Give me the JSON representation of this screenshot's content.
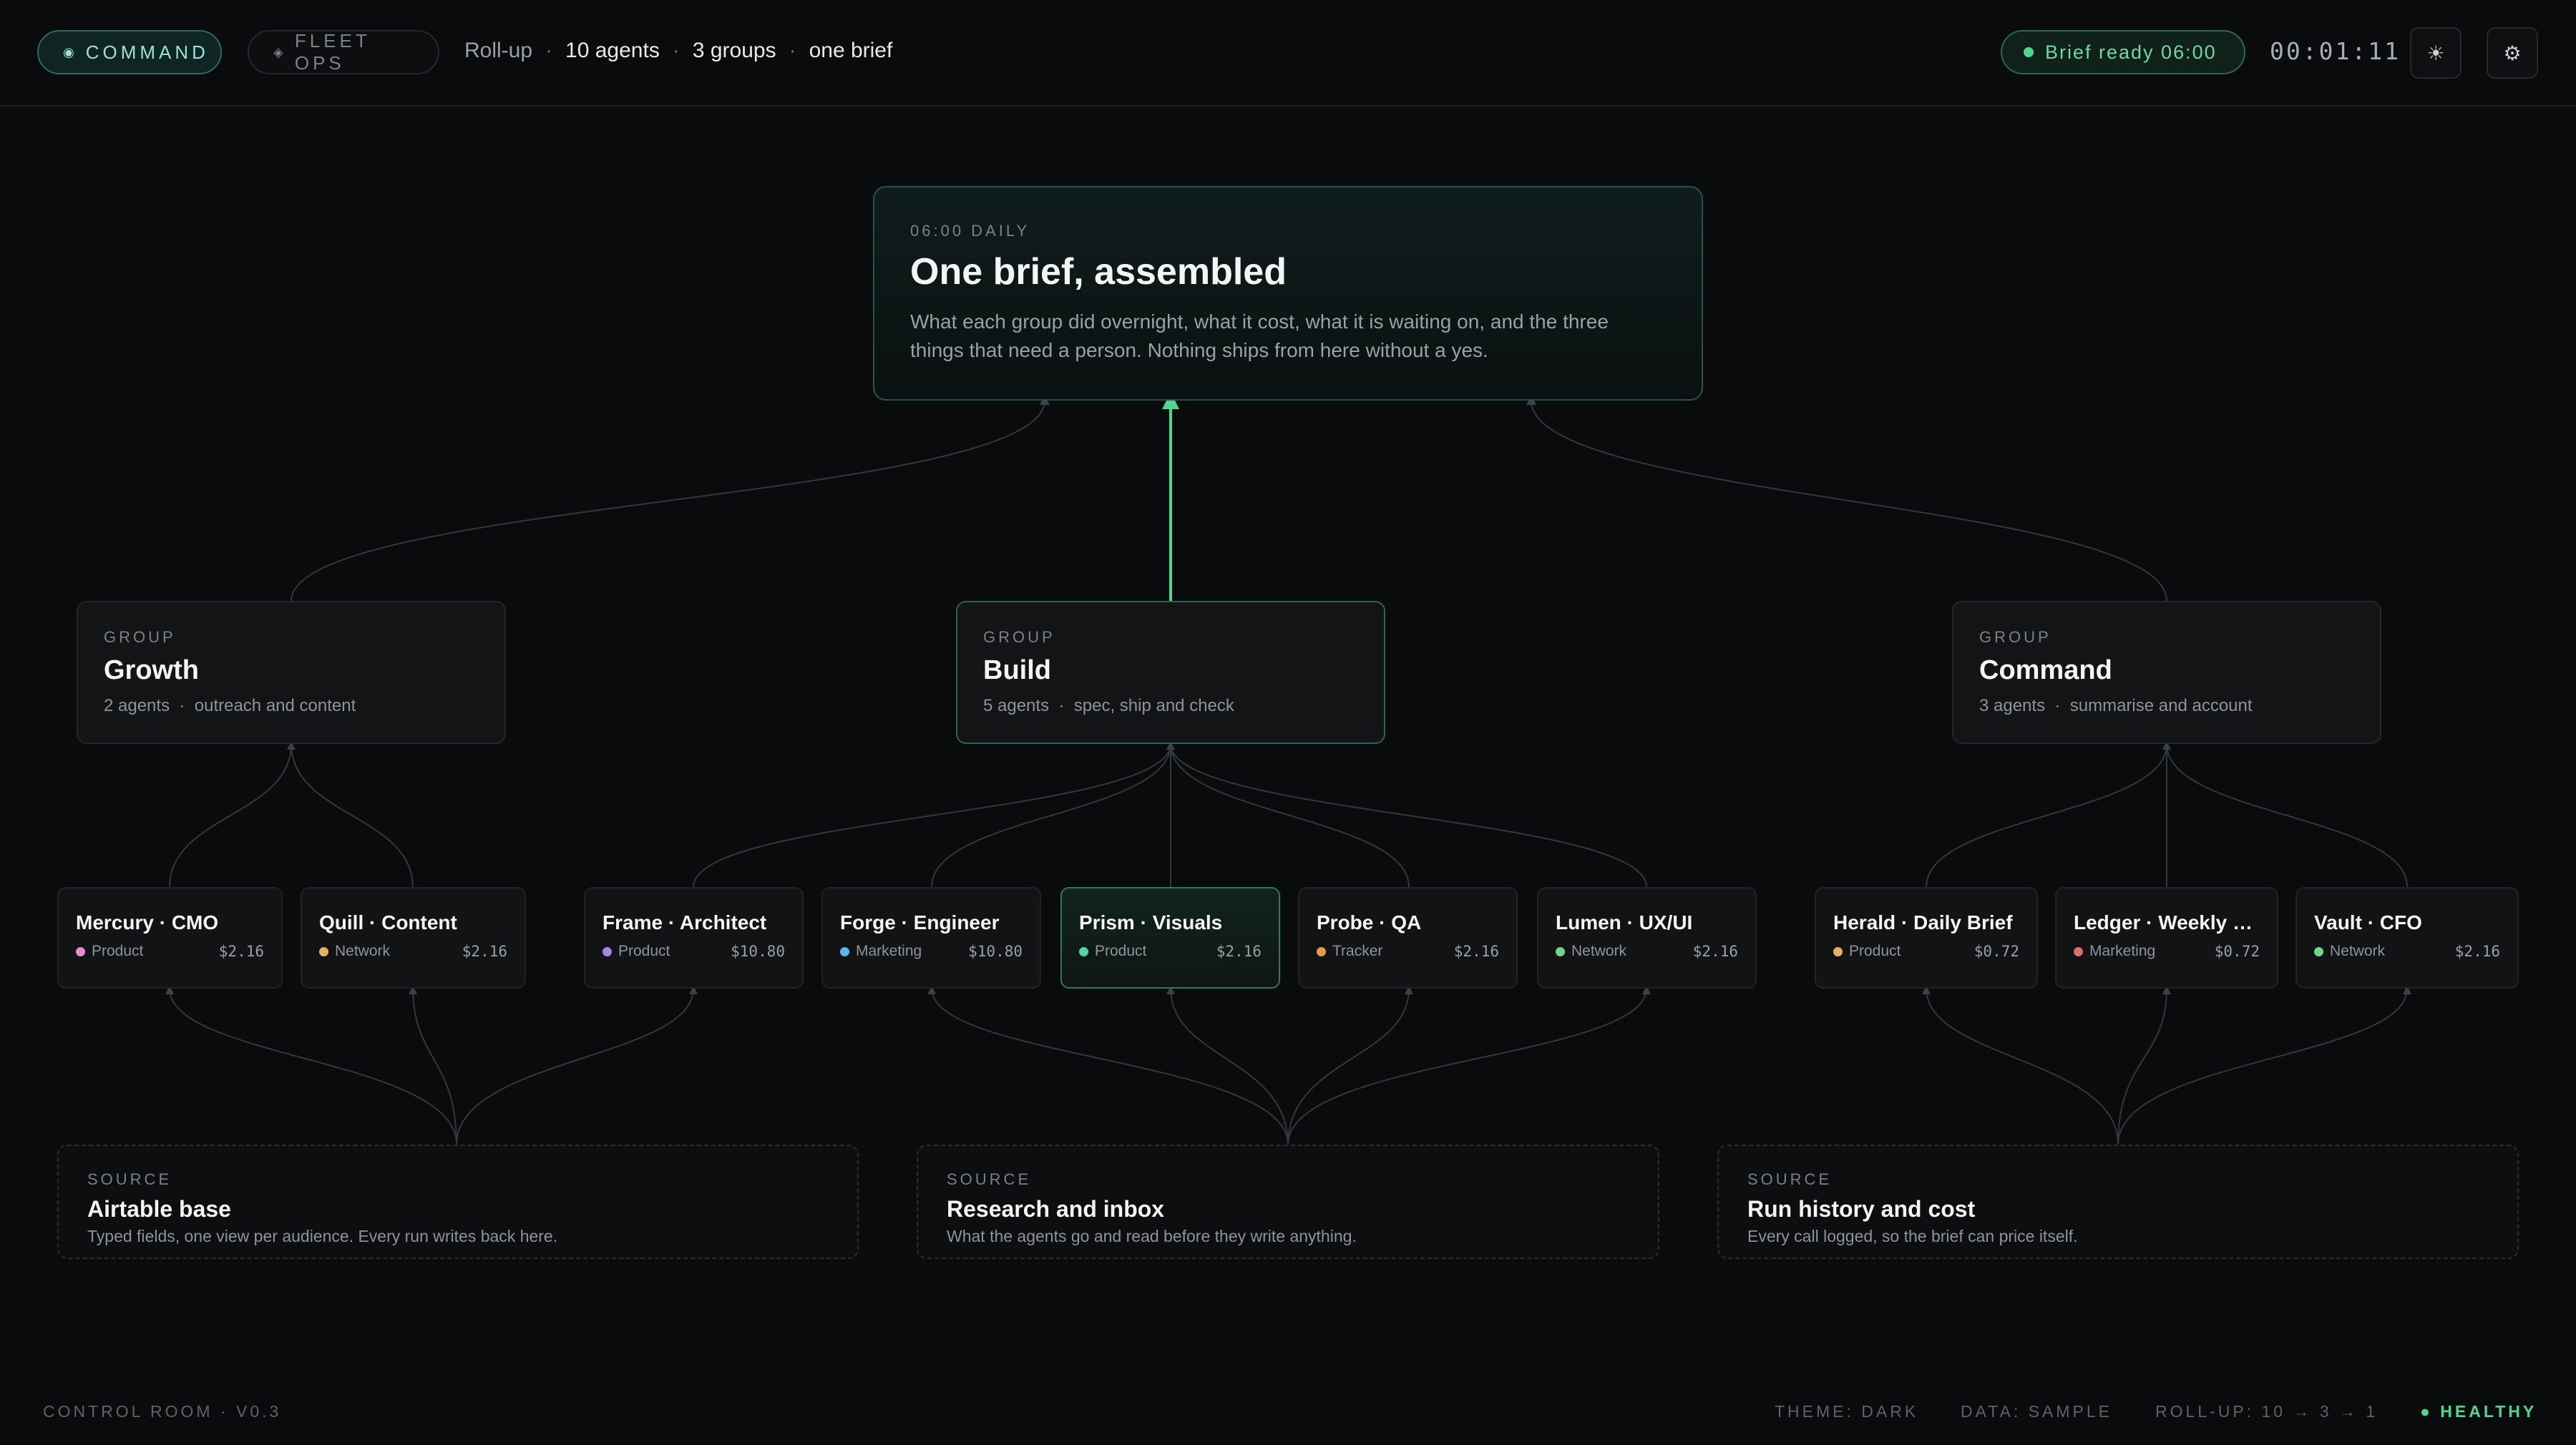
{
  "topbar": {
    "mode_command": {
      "label": "COMMAND",
      "icon": "radio-icon"
    },
    "mode_fleet": {
      "label": "FLEET OPS",
      "icon": "diamond-icon"
    },
    "rollup": {
      "prefix": "Roll-up",
      "agents": "10 agents",
      "groups": "3 groups",
      "brief": "one brief"
    },
    "brief_ready": "Brief ready 06:00",
    "timer": "00:01:11",
    "theme_icon": "sun-icon",
    "settings_icon": "gear-icon"
  },
  "brief": {
    "eyebrow": "06:00 DAILY",
    "title": "One brief, assembled",
    "description": "What each group did overnight, what it cost, what it is waiting on, and the three things that need a person. Nothing ships from here without a yes."
  },
  "groups": [
    {
      "eyebrow": "GROUP",
      "name": "Growth",
      "agents": "2 agents",
      "desc": "outreach and content"
    },
    {
      "eyebrow": "GROUP",
      "name": "Build",
      "agents": "5 agents",
      "desc": "spec, ship and check"
    },
    {
      "eyebrow": "GROUP",
      "name": "Command",
      "agents": "3 agents",
      "desc": "summarise and account"
    }
  ],
  "agents": [
    {
      "name": "Mercury · CMO",
      "tag": "Product",
      "tag_color": "#e38fce",
      "cost": "$2.16"
    },
    {
      "name": "Quill · Content",
      "tag": "Network",
      "tag_color": "#e6b060",
      "cost": "$2.16"
    },
    {
      "name": "Frame · Architect",
      "tag": "Product",
      "tag_color": "#a585e6",
      "cost": "$10.80"
    },
    {
      "name": "Forge · Engineer",
      "tag": "Marketing",
      "tag_color": "#5ab8e6",
      "cost": "$10.80"
    },
    {
      "name": "Prism · Visuals",
      "tag": "Product",
      "tag_color": "#4ed8a0",
      "cost": "$2.16"
    },
    {
      "name": "Probe · QA",
      "tag": "Tracker",
      "tag_color": "#e69a48",
      "cost": "$2.16"
    },
    {
      "name": "Lumen · UX/UI",
      "tag": "Network",
      "tag_color": "#6fd68a",
      "cost": "$2.16"
    },
    {
      "name": "Herald · Daily Brief",
      "tag": "Product",
      "tag_color": "#e6b060",
      "cost": "$0.72"
    },
    {
      "name": "Ledger · Weekly …",
      "tag": "Marketing",
      "tag_color": "#e06d6d",
      "cost": "$0.72"
    },
    {
      "name": "Vault · CFO",
      "tag": "Network",
      "tag_color": "#6fd68a",
      "cost": "$2.16"
    }
  ],
  "sources": [
    {
      "eyebrow": "SOURCE",
      "name": "Airtable base",
      "desc": "Typed fields, one view per audience. Every run writes back here."
    },
    {
      "eyebrow": "SOURCE",
      "name": "Research and inbox",
      "desc": "What the agents go and read before they write anything."
    },
    {
      "eyebrow": "SOURCE",
      "name": "Run history and cost",
      "desc": "Every call logged, so the brief can price itself."
    }
  ],
  "footer": {
    "left": "CONTROL ROOM · V0.3",
    "theme": "THEME: DARK",
    "data": "DATA: SAMPLE",
    "rollup": "ROLL-UP: 10 → 3 → 1",
    "health": "● HEALTHY"
  },
  "colors": {
    "accent": "#4ed88f",
    "accent_teal": "#9ce0d6",
    "wire": "#33383c"
  }
}
